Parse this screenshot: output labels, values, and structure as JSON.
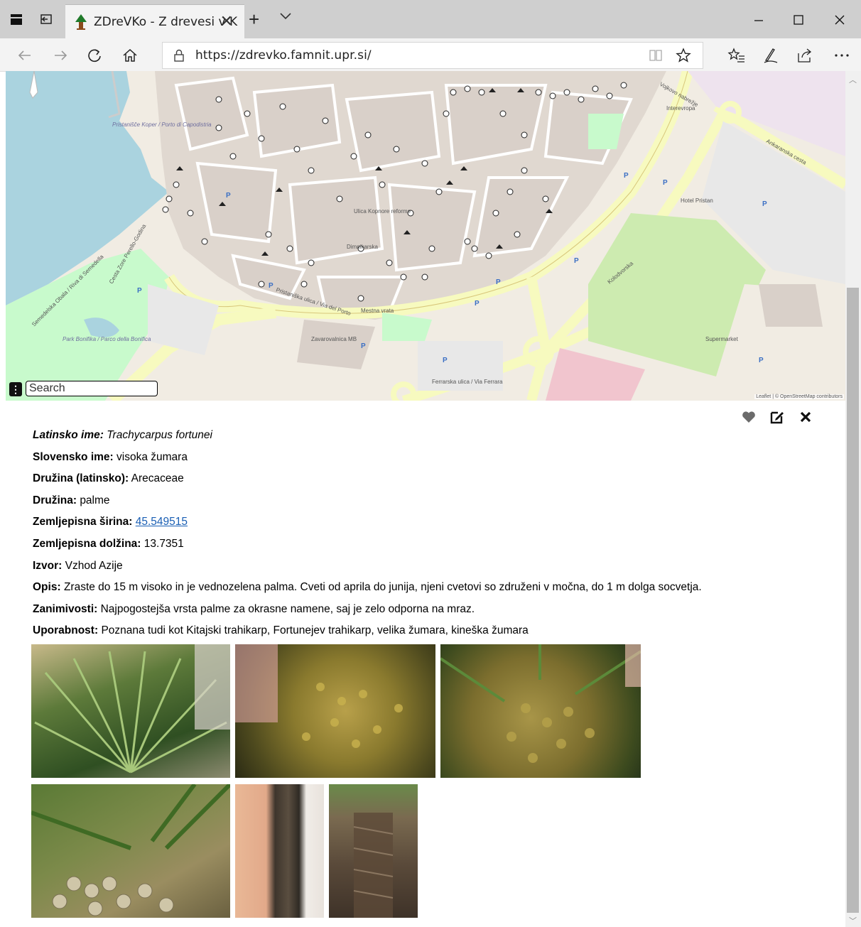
{
  "browser": {
    "tab_title": "ZDreVKo - Z drevesi v K",
    "url": "https://zdrevko.famnit.upr.si/"
  },
  "map": {
    "search_placeholder": "Search",
    "attribution": "Leaflet | © OpenStreetMap contributors",
    "labels": {
      "marina": "Pristanišče Koper / Porto di Capodistria",
      "park": "Park Bonifika / Parco della Bonifica",
      "street1": "Ulica Kopnore reforme",
      "street2": "Ferrarska ulica / Via Ferrara",
      "street3": "Ankaranska cesta",
      "street4": "Pristaniška ulica / Via del Porto",
      "street5": "Dimnikarska",
      "street6": "Semedelska Obala / Riva di Semedella",
      "street7": "Cesta Zore Perello-Godina",
      "street8": "Kolodvorska",
      "street9": "Vojkovo nabrežje",
      "poi1": "Interevropa",
      "poi2": "Hotel Pristan",
      "poi3": "Supermarket",
      "poi4": "Zavarovalnica MB",
      "poi5": "Mestna vrata"
    }
  },
  "panel": {
    "icons": {
      "favorite": "heart-icon",
      "edit": "edit-icon",
      "close": "close-icon"
    },
    "fields": {
      "latin_label": "Latinsko ime:",
      "latin_value": "Trachycarpus fortunei",
      "slo_label": "Slovensko ime:",
      "slo_value": "visoka žumara",
      "fam_latin_label": "Družina (latinsko):",
      "fam_latin_value": "Arecaceae",
      "fam_label": "Družina:",
      "fam_value": "palme",
      "lat_label": "Zemljepisna širina:",
      "lat_value": "45.549515",
      "lon_label": "Zemljepisna dolžina:",
      "lon_value": "13.7351",
      "origin_label": "Izvor:",
      "origin_value": "Vzhod Azije",
      "desc_label": "Opis:",
      "desc_value": "Zraste do 15 m visoko in je vednozelena palma. Cveti od aprila do junija, njeni cvetovi so združeni v močna, do 1 m dolga socvetja.",
      "fun_label": "Zanimivosti:",
      "fun_value": "Najpogostejša vrsta palme za okrasne namene, saj je zelo odporna na mraz.",
      "use_label": "Uporabnost:",
      "use_value": "Poznana tudi kot Kitajski trahikarp, Fortunejev trahikarp, velika žumara, kineška žumara"
    }
  }
}
